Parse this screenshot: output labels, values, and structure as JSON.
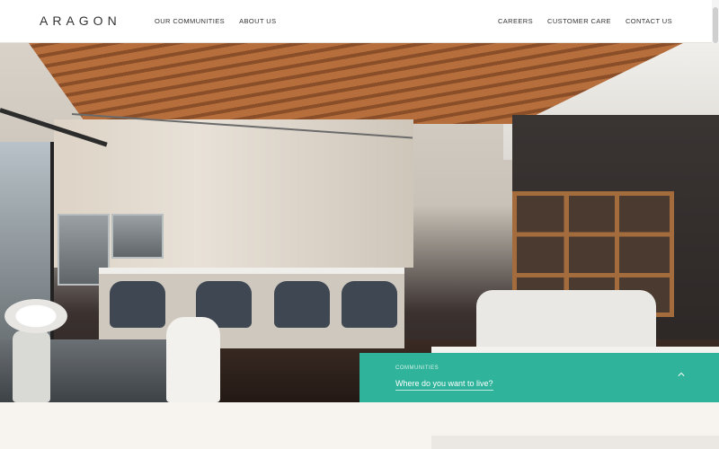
{
  "header": {
    "logo": "ARAGON",
    "nav_left": [
      {
        "label": "OUR COMMUNITIES"
      },
      {
        "label": "ABOUT US"
      }
    ],
    "nav_right": [
      {
        "label": "CAREERS"
      },
      {
        "label": "CUSTOMER CARE"
      },
      {
        "label": "CONTACT US"
      }
    ]
  },
  "hero": {
    "image_alt": "Modern kitchen and living room interior"
  },
  "communities": {
    "label": "COMMUNITIES",
    "question": "Where do you want to live?",
    "accent_color": "#2fb39a",
    "icon": "chevron-up-icon"
  }
}
